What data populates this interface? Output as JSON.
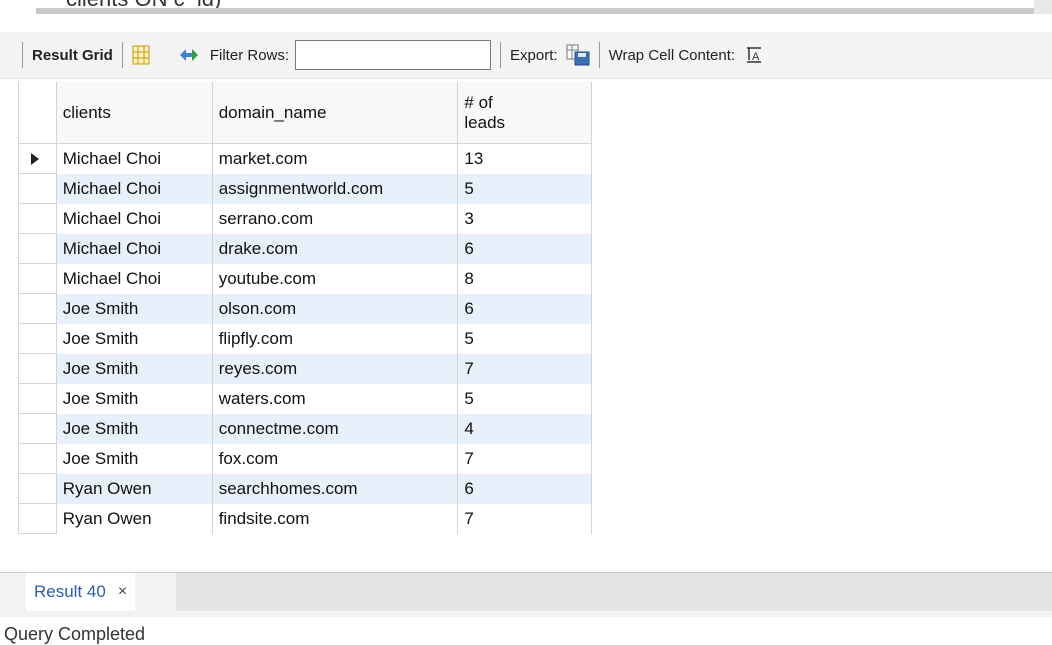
{
  "editor": {
    "code_remnant": "clients ON c_id)"
  },
  "toolbar": {
    "result_grid_label": "Result Grid",
    "filter_rows_label": "Filter Rows:",
    "filter_value": "",
    "export_label": "Export:",
    "wrap_label": "Wrap Cell Content:"
  },
  "grid": {
    "columns": [
      "clients",
      "domain_name",
      "# of\nleads"
    ],
    "rows": [
      [
        "Michael Choi",
        "market.com",
        "13"
      ],
      [
        "Michael Choi",
        "assignmentworld.com",
        "5"
      ],
      [
        "Michael Choi",
        "serrano.com",
        "3"
      ],
      [
        "Michael Choi",
        "drake.com",
        "6"
      ],
      [
        "Michael Choi",
        "youtube.com",
        "8"
      ],
      [
        "Joe Smith",
        "olson.com",
        "6"
      ],
      [
        "Joe Smith",
        "flipfly.com",
        "5"
      ],
      [
        "Joe Smith",
        "reyes.com",
        "7"
      ],
      [
        "Joe Smith",
        "waters.com",
        "5"
      ],
      [
        "Joe Smith",
        "connectme.com",
        "4"
      ],
      [
        "Joe Smith",
        "fox.com",
        "7"
      ],
      [
        "Ryan Owen",
        "searchhomes.com",
        "6"
      ],
      [
        "Ryan Owen",
        "findsite.com",
        "7"
      ]
    ],
    "selected_row_index": 0
  },
  "tabs": [
    {
      "label": "Result 40",
      "close": "×"
    }
  ],
  "status": {
    "text": "Query Completed"
  },
  "colors": {
    "accent": "#2a5db0",
    "row_alt": "#e8f0fb"
  }
}
